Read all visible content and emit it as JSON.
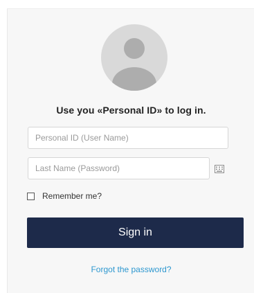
{
  "login": {
    "heading": "Use you «Personal ID» to log in.",
    "username_placeholder": "Personal ID (User Name)",
    "password_placeholder": "Last Name (Password)",
    "remember_label": "Remember me?",
    "remember_checked": false,
    "signin_label": "Sign in",
    "forgot_link": "Forgot the password?"
  },
  "icons": {
    "avatar": "user-avatar-icon",
    "keyboard": "keyboard-icon"
  },
  "colors": {
    "button_bg": "#1d2a4a",
    "link": "#2d97cf",
    "panel_bg": "#f7f7f7",
    "avatar_bg": "#d9d9d9",
    "avatar_fg": "#adadad"
  }
}
